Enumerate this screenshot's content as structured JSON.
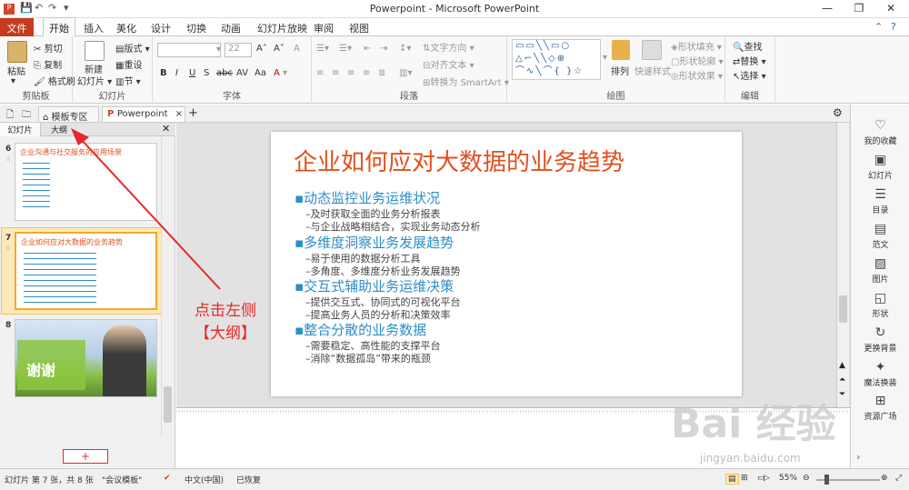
{
  "window": {
    "title": "Powerpoint - Microsoft PowerPoint",
    "controls": [
      "—",
      "❐",
      "✕"
    ]
  },
  "ribbon_tabs": [
    "文件",
    "开始",
    "插入",
    "美化",
    "设计",
    "切换",
    "动画",
    "幻灯片放映",
    "审阅",
    "视图"
  ],
  "ribbon": {
    "clipboard": {
      "label": "剪贴板",
      "paste": "粘贴",
      "cut": "剪切",
      "copy": "复制",
      "format_painter": "格式刷"
    },
    "slides": {
      "label": "幻灯片",
      "new_slide": "新建",
      "new_slide2": "幻灯片 ▾",
      "layout": "版式 ▾",
      "reset": "重设",
      "section": "节 ▾"
    },
    "font": {
      "label": "字体",
      "font_size": "22"
    },
    "paragraph": {
      "label": "段落",
      "text_direction": "文字方向 ▾",
      "align_text": "对齐文本 ▾",
      "smartart": "转换为 SmartArt ▾"
    },
    "drawing": {
      "label": "绘图",
      "arrange": "排列",
      "quick_styles": "快速样式",
      "shape_fill": "形状填充 ▾",
      "shape_outline": "形状轮廓 ▾",
      "shape_effects": "形状效果 ▾"
    },
    "editing": {
      "label": "编辑",
      "find": "查找",
      "replace": "替换 ▾",
      "select": "选择 ▾"
    }
  },
  "doc_tabs": {
    "template_zone": "模板专区",
    "current": "Powerpoint"
  },
  "left_panel": {
    "tabs": [
      "幻灯片",
      "大纲"
    ],
    "slides": [
      {
        "number": "6",
        "title": "企业沟通与社交服务的应用场景"
      },
      {
        "number": "7",
        "title": "企业如何应对大数据的业务趋势"
      },
      {
        "number": "8",
        "title": "谢谢"
      }
    ],
    "add_button": "+"
  },
  "slide": {
    "title": "企业如何应对大数据的业务趋势",
    "sections": [
      {
        "heading": "▪动态监控业务运维状况",
        "items": [
          "–及时获取全面的业务分析报表",
          "–与企业战略相结合，实现业务动态分析"
        ]
      },
      {
        "heading": "▪多维度洞察业务发展趋势",
        "items": [
          "–易于使用的数据分析工具",
          "–多角度、多维度分析业务发展趋势"
        ]
      },
      {
        "heading": "▪交互式辅助业务运维决策",
        "items": [
          "–提供交互式、协同式的可视化平台",
          "–提高业务人员的分析和决策效率"
        ]
      },
      {
        "heading": "▪整合分散的业务数据",
        "items": [
          "–需要稳定、高性能的支撑平台",
          "–消除“数据孤岛”带来的瓶颈"
        ]
      }
    ]
  },
  "annotation": {
    "line1": "点击左侧",
    "line2": "【大纲】",
    "color": "#e3292b"
  },
  "right_panel": [
    {
      "icon": "heart-icon",
      "label": "我的收藏"
    },
    {
      "icon": "slides-icon",
      "label": "幻灯片"
    },
    {
      "icon": "list-icon",
      "label": "目录"
    },
    {
      "icon": "text-icon",
      "label": "范文"
    },
    {
      "icon": "image-icon",
      "label": "图片"
    },
    {
      "icon": "shape-icon",
      "label": "形状"
    },
    {
      "icon": "refresh-icon",
      "label": "更换背景"
    },
    {
      "icon": "magic-icon",
      "label": "魔法换装"
    },
    {
      "icon": "grid-icon",
      "label": "资源广场"
    }
  ],
  "status": {
    "slide_info": "幻灯片 第 7 张，共 8 张",
    "theme": "\"会议模板\"",
    "language": "中文(中国)",
    "recovered": "已恢复",
    "zoom": "55%"
  },
  "watermark": {
    "brand": "Bai 经验",
    "url": "jingyan.baidu.com"
  },
  "colors": {
    "file_tab": "#c43b1d",
    "slide_title": "#e0501d",
    "bullet_heading": "#2d8dc8",
    "arrow": "#e3292b"
  }
}
